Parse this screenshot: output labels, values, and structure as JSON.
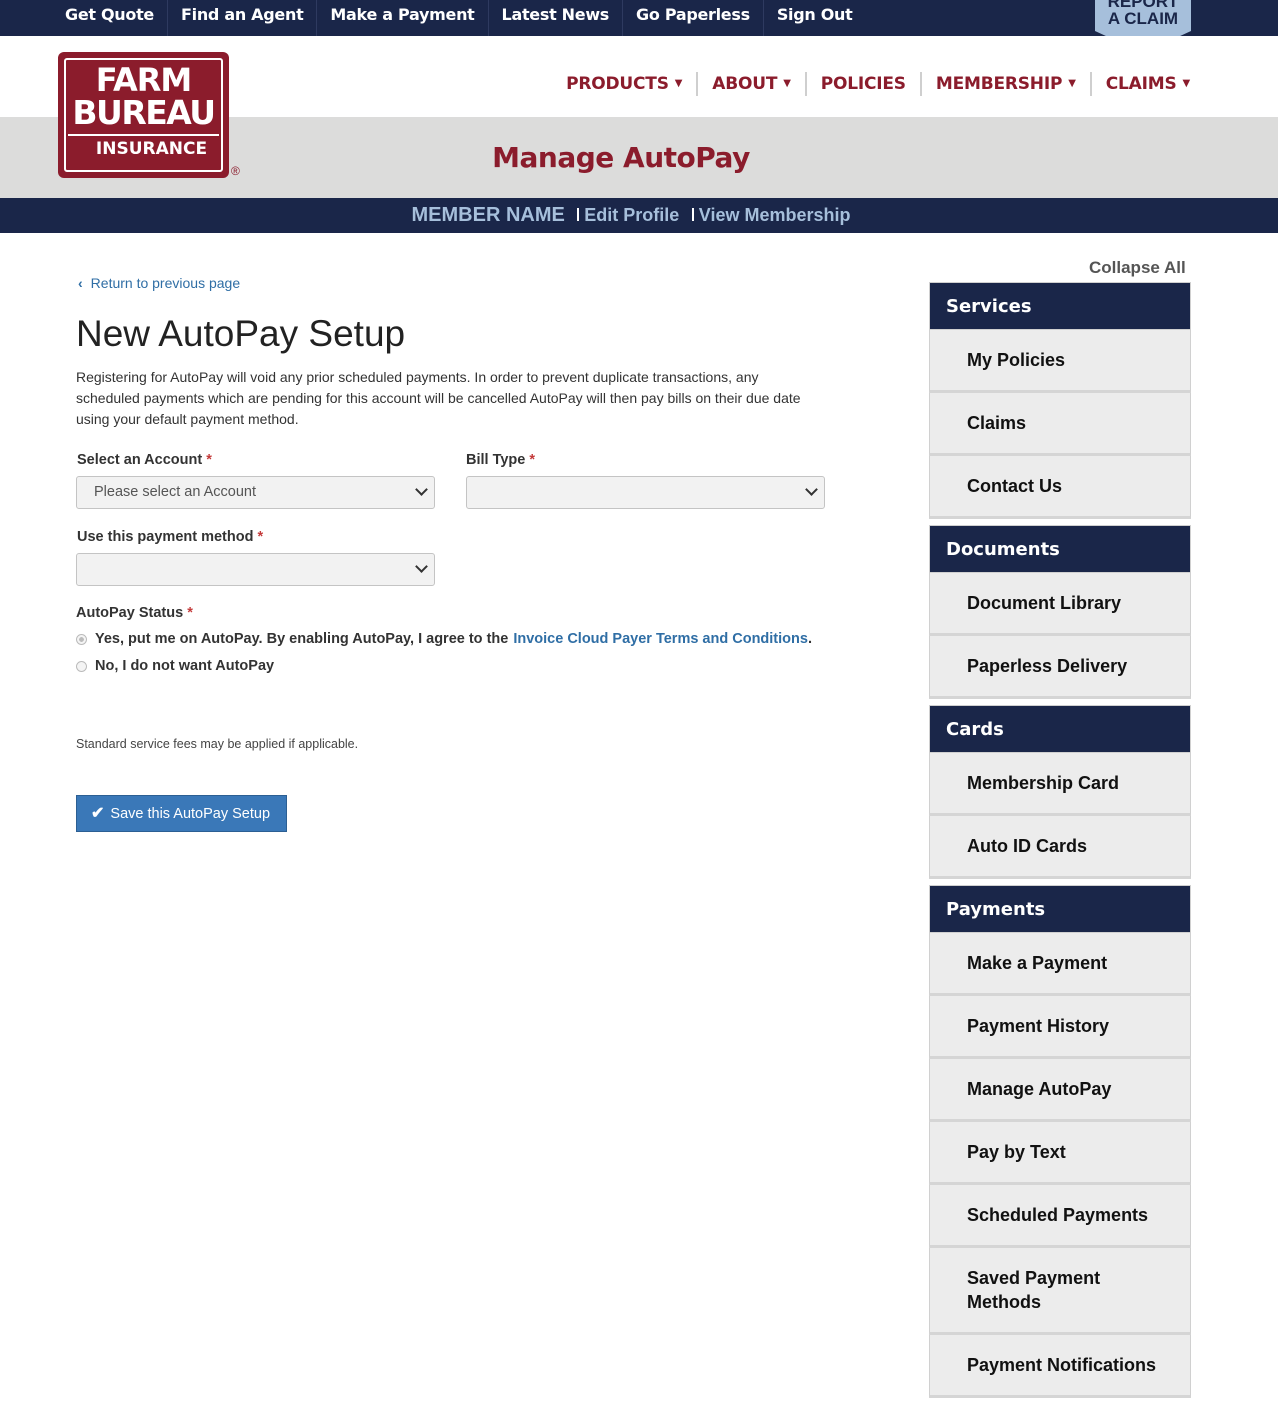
{
  "topnav": {
    "items": [
      "Get Quote",
      "Find an Agent",
      "Make a Payment",
      "Latest News",
      "Go Paperless",
      "Sign Out"
    ],
    "report_line1": "REPORT",
    "report_line2": "A CLAIM"
  },
  "logo": {
    "line1": "FARM",
    "line2": "BUREAU",
    "line3": "INSURANCE",
    "registered": "®"
  },
  "mainnav": {
    "products": "PRODUCTS",
    "about": "ABOUT",
    "policies": "POLICIES",
    "membership": "MEMBERSHIP",
    "claims": "CLAIMS"
  },
  "banner": {
    "title": "Manage AutoPay"
  },
  "memberbar": {
    "name": "MEMBER NAME",
    "edit_profile": "Edit Profile",
    "view_membership": "View Membership"
  },
  "main": {
    "back_link": "Return to previous page",
    "heading": "New AutoPay Setup",
    "description": "Registering for AutoPay will void any prior scheduled payments. In order to prevent duplicate transactions, any scheduled payments which are pending for this account will be cancelled AutoPay will then pay bills on their due date using your default payment method.",
    "account_label": "Select an Account",
    "account_placeholder": "Please select an Account",
    "bill_type_label": "Bill Type",
    "bill_type_value": "",
    "payment_method_label": "Use this payment method",
    "payment_method_value": "",
    "required_mark": "*",
    "status_label": "AutoPay Status",
    "option_yes": "Yes, put me on AutoPay. By enabling AutoPay, I agree to the",
    "option_yes_link": "Invoice Cloud Payer Terms and Conditions",
    "option_no": "No, I do not want AutoPay",
    "fees_note": "Standard service fees may be applied if applicable.",
    "save_button": "Save this AutoPay Setup"
  },
  "sidebar": {
    "collapse_all": "Collapse All",
    "sections": [
      {
        "title": "Services",
        "items": [
          "My Policies",
          "Claims",
          "Contact Us"
        ]
      },
      {
        "title": "Documents",
        "items": [
          "Document Library",
          "Paperless Delivery"
        ]
      },
      {
        "title": "Cards",
        "items": [
          "Membership Card",
          "Auto ID Cards"
        ]
      },
      {
        "title": "Payments",
        "items": [
          "Make a Payment",
          "Payment History",
          "Manage AutoPay",
          "Pay by Text",
          "Scheduled Payments",
          "Saved Payment Methods",
          "Payment Notifications"
        ]
      }
    ]
  },
  "colors": {
    "navy": "#1a2649",
    "brand_red": "#8b1c2c",
    "light_blue": "#a6bfdb",
    "link_blue": "#2f6ea5",
    "button_blue": "#3a78b8"
  }
}
